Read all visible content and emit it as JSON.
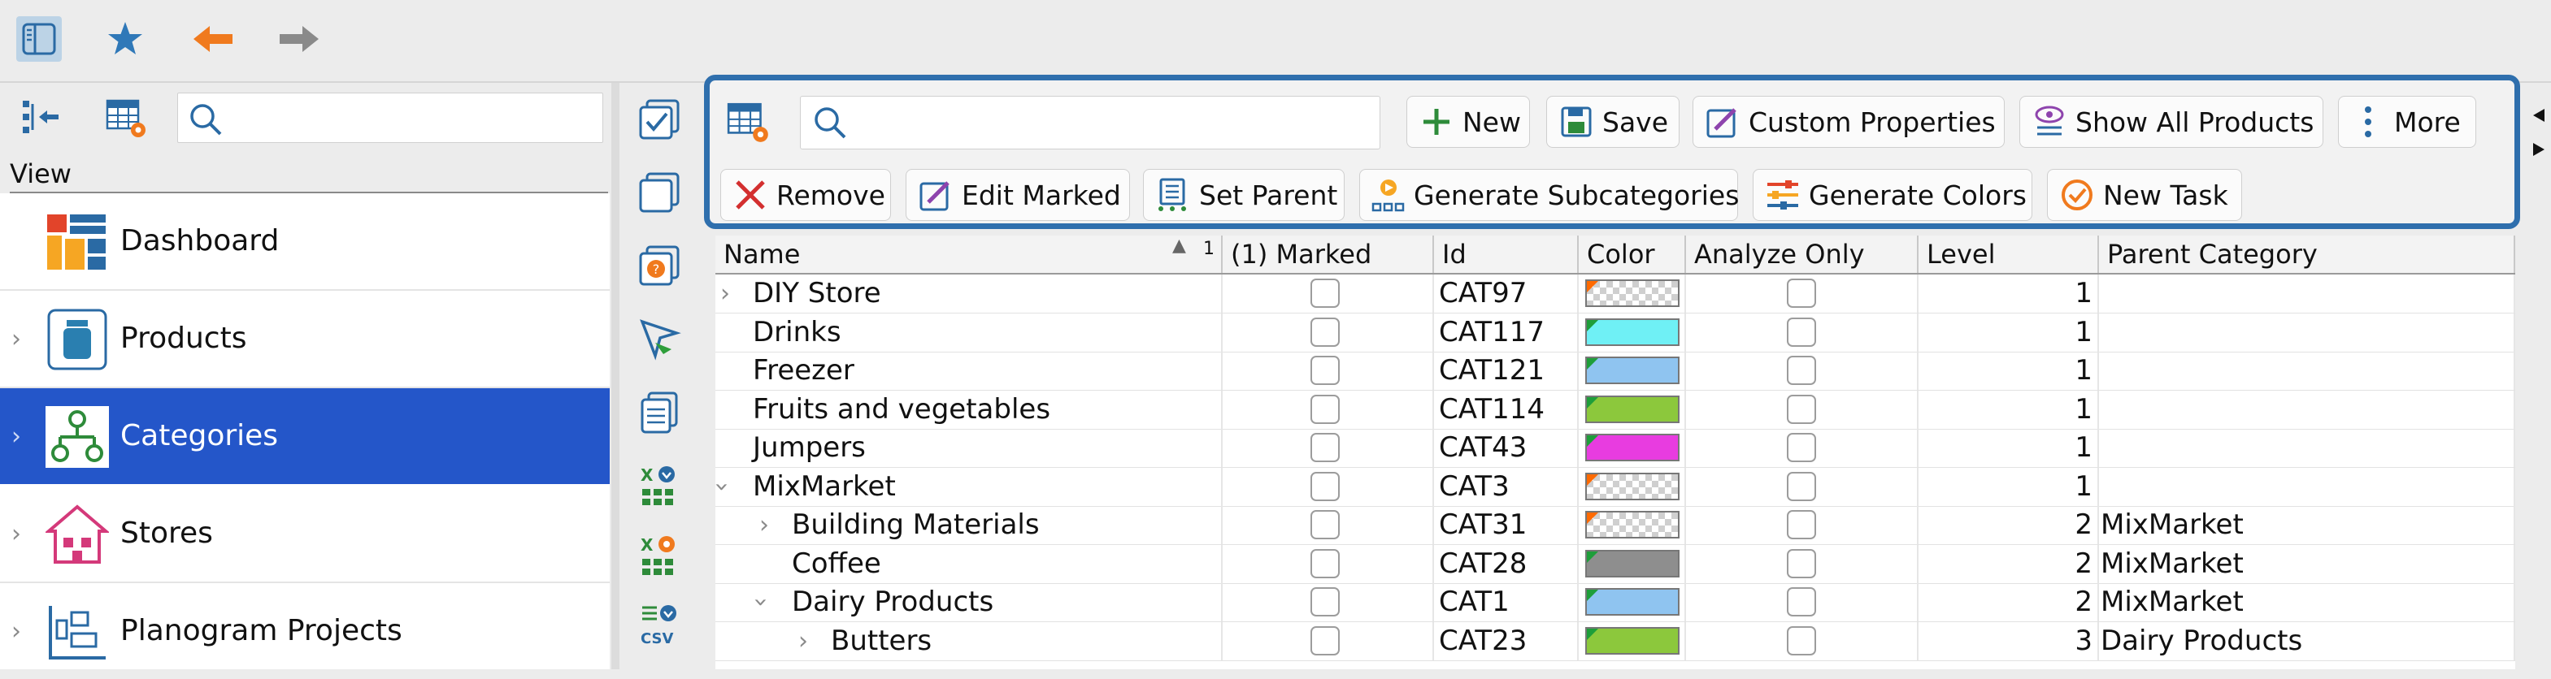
{
  "left_panel": {
    "view_label": "View",
    "nav_items": [
      {
        "label": "Dashboard",
        "icon": "dashboard-icon",
        "has_children": false,
        "selected": false
      },
      {
        "label": "Products",
        "icon": "products-icon",
        "has_children": true,
        "selected": false
      },
      {
        "label": "Categories",
        "icon": "categories-icon",
        "has_children": true,
        "selected": true
      },
      {
        "label": "Stores",
        "icon": "stores-icon",
        "has_children": true,
        "selected": false
      },
      {
        "label": "Planogram Projects",
        "icon": "planogram-projects-icon",
        "has_children": true,
        "selected": false
      }
    ]
  },
  "toolbar": {
    "new": "New",
    "save": "Save",
    "custom_properties": "Custom Properties",
    "show_all_products": "Show All Products",
    "more": "More",
    "remove": "Remove",
    "edit_marked": "Edit Marked",
    "set_parent": "Set Parent",
    "generate_subcategories": "Generate Subcategories",
    "generate_colors": "Generate Colors",
    "new_task": "New Task"
  },
  "table": {
    "columns": {
      "name": "Name",
      "sort_index": "1",
      "marked": "(1) Marked",
      "id": "Id",
      "color": "Color",
      "analyze_only": "Analyze Only",
      "level": "Level",
      "parent_category": "Parent Category"
    },
    "rows": [
      {
        "name": "DIY Store",
        "indent": 0,
        "expander": "collapsed",
        "id": "CAT97",
        "color": "checker",
        "corner": "orange",
        "level": "1",
        "parent": ""
      },
      {
        "name": "Drinks",
        "indent": 0,
        "expander": "none",
        "id": "CAT117",
        "color": "#6ff0f5",
        "corner": "green",
        "level": "1",
        "parent": ""
      },
      {
        "name": "Freezer",
        "indent": 0,
        "expander": "none",
        "id": "CAT121",
        "color": "#8fc4f0",
        "corner": "green",
        "level": "1",
        "parent": ""
      },
      {
        "name": "Fruits and vegetables",
        "indent": 0,
        "expander": "none",
        "id": "CAT114",
        "color": "#8cc83c",
        "corner": "green",
        "level": "1",
        "parent": ""
      },
      {
        "name": "Jumpers",
        "indent": 0,
        "expander": "none",
        "id": "CAT43",
        "color": "#e83ce0",
        "corner": "green",
        "level": "1",
        "parent": ""
      },
      {
        "name": "MixMarket",
        "indent": 0,
        "expander": "expanded",
        "id": "CAT3",
        "color": "checker",
        "corner": "orange",
        "level": "1",
        "parent": ""
      },
      {
        "name": "Building Materials",
        "indent": 1,
        "expander": "collapsed",
        "id": "CAT31",
        "color": "checker",
        "corner": "orange",
        "level": "2",
        "parent": "MixMarket"
      },
      {
        "name": "Coffee",
        "indent": 1,
        "expander": "none",
        "id": "CAT28",
        "color": "#8e8e8e",
        "corner": "green",
        "level": "2",
        "parent": "MixMarket"
      },
      {
        "name": "Dairy Products",
        "indent": 1,
        "expander": "expanded",
        "id": "CAT1",
        "color": "#8fc4f0",
        "corner": "green",
        "level": "2",
        "parent": "MixMarket"
      },
      {
        "name": "Butters",
        "indent": 2,
        "expander": "collapsed",
        "id": "CAT23",
        "color": "#8cc83c",
        "corner": "green",
        "level": "3",
        "parent": "Dairy Products"
      }
    ]
  },
  "colors": {
    "selection": "#2456c9",
    "toolbar_highlight": "#2f6fad",
    "accent_orange": "#ff6a00",
    "accent_green": "#1e9e3a"
  }
}
